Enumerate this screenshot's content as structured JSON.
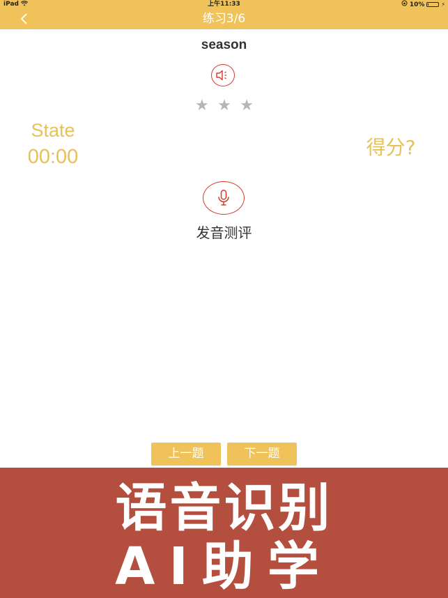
{
  "status_bar": {
    "carrier": "iPad",
    "time": "上午11:33",
    "battery_text": "10%",
    "battery_level": 0.1,
    "icons": [
      "wifi-icon",
      "lock-rotation-icon",
      "battery-icon",
      "charging-bolt-icon"
    ]
  },
  "nav": {
    "back_icon": "chevron-left-icon",
    "title": "练习3/6"
  },
  "exercise": {
    "word": "season",
    "speaker_icon": "speaker-icon",
    "stars": [
      "★",
      "★",
      "★"
    ],
    "star_color": "#b5b5b5",
    "state_label": "State",
    "state_time": "00:00",
    "score_label": "得分?",
    "mic_icon": "microphone-icon",
    "mic_label": "发音测评"
  },
  "buttons": {
    "prev": "上一题",
    "next": "下一题"
  },
  "banner": {
    "line1": "语音识别",
    "line2": "AI助学"
  },
  "colors": {
    "accent": "#efc35a",
    "highlight_text": "#e8c15a",
    "icon_red": "#d43a2a",
    "banner": "#b44e3e"
  }
}
